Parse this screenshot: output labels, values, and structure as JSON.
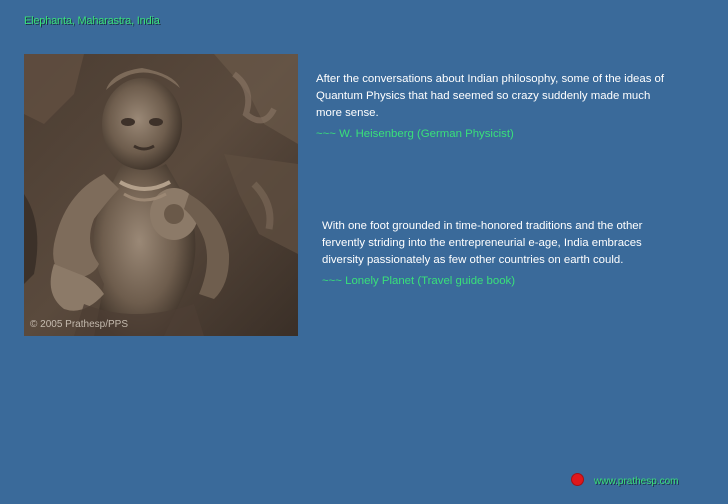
{
  "caption": {
    "location": "Elephanta, Maharastra, India"
  },
  "photo": {
    "copyright": "© 2005 Prathesp/PPS"
  },
  "quotes": [
    {
      "text": "After the conversations about Indian philosophy, some of the ideas of Quantum Physics that had seemed so crazy suddenly made much more sense.",
      "attribution": "~~~ W. Heisenberg (German Physicist)"
    },
    {
      "text": "With one foot grounded in time-honored traditions and the other fervently striding into the entrepreneurial e-age, India embraces diversity passionately as few other countries on earth could.",
      "attribution": "~~~ Lonely Planet (Travel guide book)"
    }
  ],
  "footer": {
    "website": "www.prathesp.com"
  },
  "colors": {
    "background": "#3a6a9a",
    "accent_green": "#39e07a",
    "dot_red": "#e0171b"
  }
}
